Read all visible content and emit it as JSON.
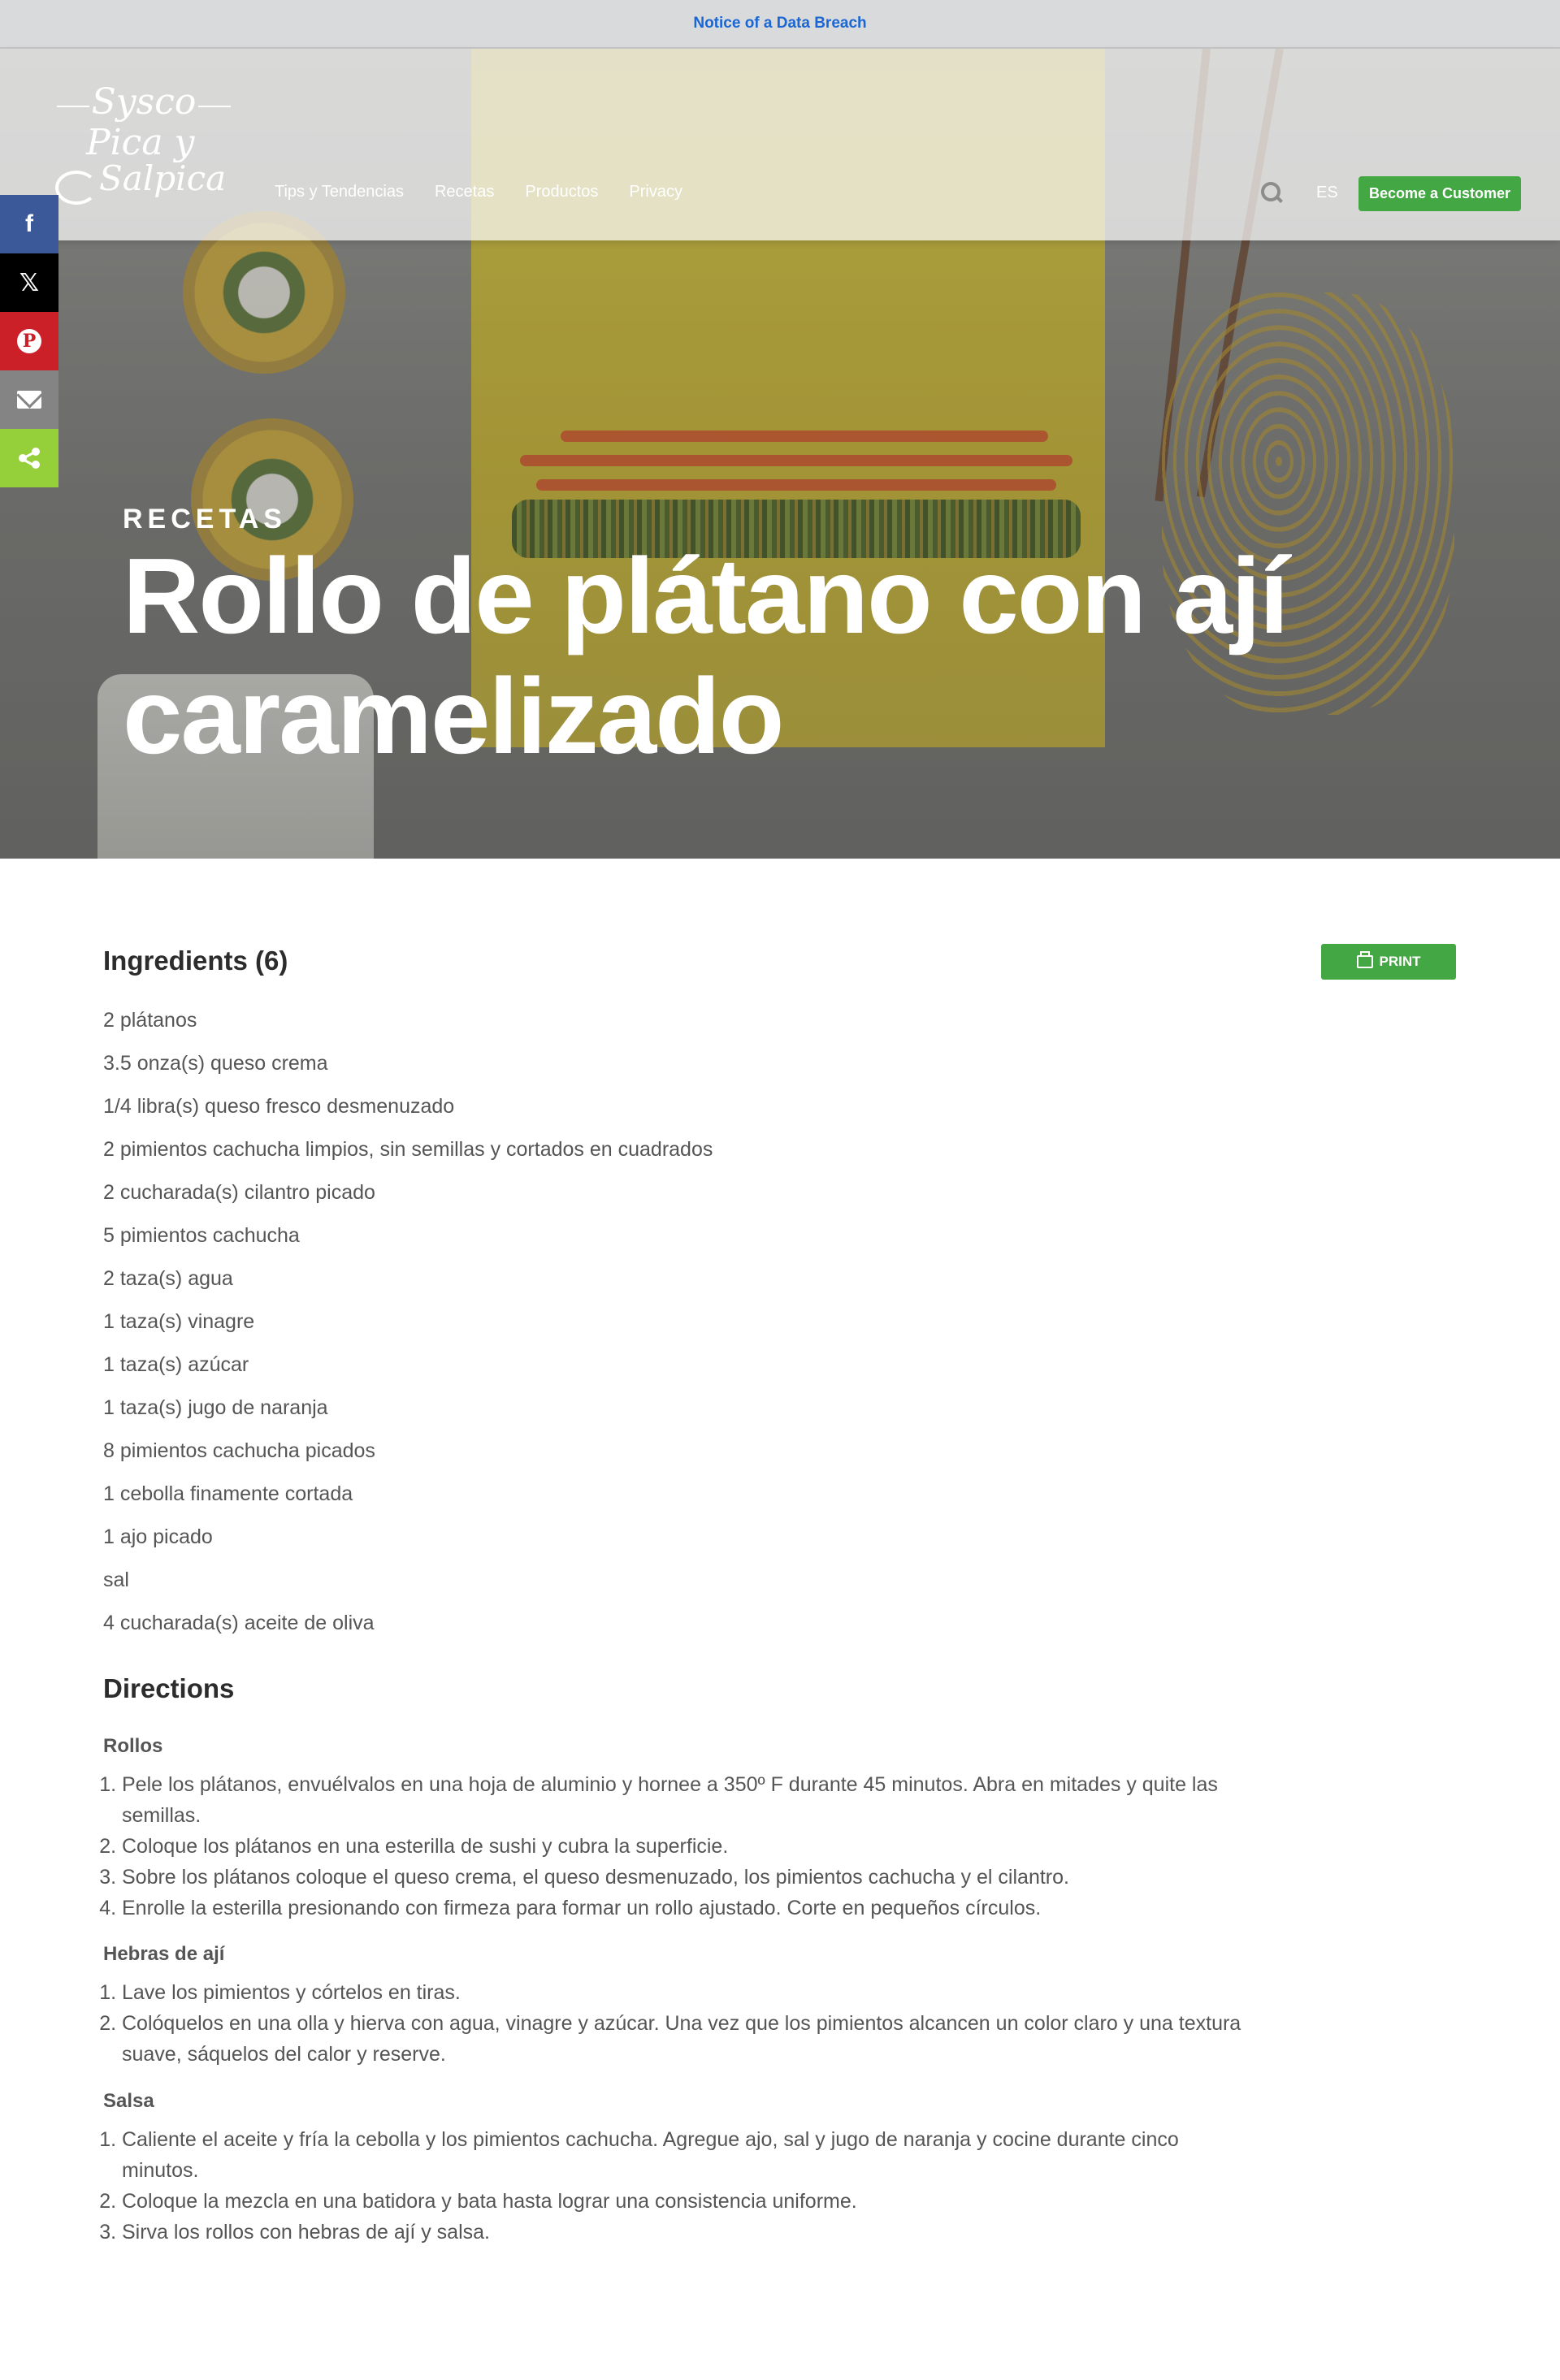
{
  "notice": {
    "label": "Notice of a Data Breach"
  },
  "logo": {
    "brand": "Sysco",
    "line1": "Pica y",
    "line2": "Salpica"
  },
  "nav": {
    "items": [
      "Tips y Tendencias",
      "Recetas",
      "Productos",
      "Privacy"
    ]
  },
  "header": {
    "lang": "ES",
    "cta": "Become a Customer"
  },
  "share": {
    "facebook": "f",
    "x": "𝕏",
    "pinterest": "P"
  },
  "hero": {
    "eyebrow": "RECETAS",
    "title": "Rollo de plátano con ají caramelizado"
  },
  "ingredients": {
    "title": "Ingredients (6)",
    "print_label": "PRINT",
    "items": [
      "2 plátanos",
      "3.5 onza(s) queso crema",
      "1/4 libra(s) queso fresco desmenuzado",
      "2 pimientos cachucha limpios, sin semillas y cortados en cuadrados",
      "2 cucharada(s) cilantro picado",
      "5 pimientos cachucha",
      "2 taza(s) agua",
      "1 taza(s) vinagre",
      "1 taza(s) azúcar",
      "1 taza(s) jugo de naranja",
      "8 pimientos cachucha picados",
      "1 cebolla finamente cortada",
      "1 ajo picado",
      "sal",
      "4 cucharada(s) aceite de oliva"
    ]
  },
  "directions": {
    "title": "Directions",
    "sections": [
      {
        "heading": "Rollos",
        "steps": [
          "Pele los plátanos, envuélvalos en una hoja de aluminio y hornee a 350º F durante 45 minutos. Abra en mitades y quite las semillas.",
          "Coloque los plátanos en una esterilla de sushi y cubra la superficie.",
          "Sobre los plátanos coloque el queso crema, el queso desmenuzado, los pimientos cachucha y el cilantro.",
          "Enrolle la esterilla presionando con firmeza para formar un rollo ajustado. Corte en pequeños círculos."
        ]
      },
      {
        "heading": "Hebras de ají",
        "steps": [
          "Lave los pimientos y córtelos en tiras.",
          "Colóquelos en una olla y hierva con agua, vinagre y azúcar. Una vez que los pimientos alcancen un color claro y una textura suave, sáquelos del calor y reserve."
        ]
      },
      {
        "heading": "Salsa",
        "steps": [
          "Caliente el aceite y fría la cebolla y los pimientos cachucha. Agregue ajo, sal y jugo de naranja y cocine durante cinco minutos.",
          "Coloque la mezcla en una batidora y bata hasta lograr una consistencia uniforme.",
          "Sirva los rollos con hebras de ají y salsa."
        ]
      }
    ]
  },
  "colors": {
    "accent_green": "#43a743",
    "notice_link": "#1a66d4",
    "facebook": "#3b5998",
    "pinterest": "#cb2027",
    "share_green": "#95d03a"
  }
}
